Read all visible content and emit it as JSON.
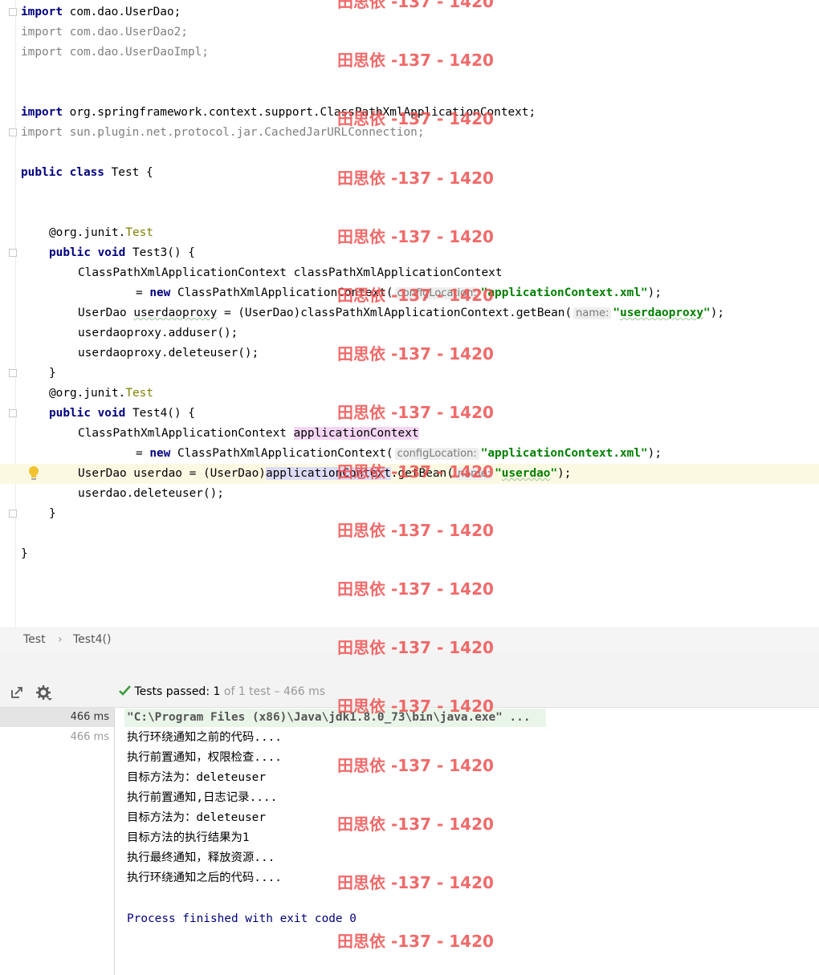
{
  "editor": {
    "imports": [
      {
        "kw": "import",
        "path": "com.dao.UserDao;",
        "unused": false
      },
      {
        "kw": "import",
        "path": "com.dao.UserDao2;",
        "unused": true
      },
      {
        "kw": "import",
        "path": "com.dao.UserDaoImpl;",
        "unused": true
      },
      {
        "kw": "import",
        "path": "org.springframework.context.support.ClassPathXmlApplicationContext;",
        "unused": false
      },
      {
        "kw": "import",
        "path": "sun.plugin.net.protocol.jar.CachedJarURLConnection;",
        "unused": true
      }
    ],
    "class_decl": {
      "kw": "public class",
      "rest": " Test {"
    },
    "test3": {
      "annotation_prefix": "@org.junit.",
      "annotation_name": "Test",
      "sig_kw": "public void",
      "sig_rest": " Test3() {",
      "l1": "ClassPathXmlApplicationContext classPathXmlApplicationContext",
      "l2_eq": "= ",
      "l2_kw": "new",
      "l2_rest": " ClassPathXmlApplicationContext(",
      "l2_hint": "configLocation:",
      "l2_str": "\"applicationContext.xml\"",
      "l2_end": ");",
      "l3_pre": "UserDao ",
      "l3_var": "userdaoproxy",
      "l3_mid": " = (UserDao)classPathXmlApplicationContext.getBean(",
      "l3_hint": "name:",
      "l3_str_q1": "\"",
      "l3_str": "userdaoproxy",
      "l3_str_q2": "\"",
      "l3_end": ");",
      "l4": "userdaoproxy.adduser();",
      "l5": "userdaoproxy.deleteuser();",
      "close": "}"
    },
    "test4": {
      "annotation_prefix": "@org.junit.",
      "annotation_name": "Test",
      "sig_kw": "public void",
      "sig_rest": " Test4() {",
      "l1_pre": "ClassPathXmlApplicationContext ",
      "l1_var": "applicationContext",
      "l2_eq": "= ",
      "l2_kw": "new",
      "l2_rest": " ClassPathXmlApplicationContext(",
      "l2_hint": "configLocation:",
      "l2_str": "\"applicationContext.xml\"",
      "l2_end": ");",
      "l3_pre": "UserDao userdao = (UserDao)",
      "l3_var": "applicationContext",
      "l3_mid": ".getBean(",
      "l3_hint": "name:",
      "l3_str_q1": "\"",
      "l3_str": "userdao",
      "l3_str_q2": "\"",
      "l3_end": ");",
      "l4": "userdao.deleteuser();",
      "close": "}"
    },
    "class_close": "}"
  },
  "breadcrumb": {
    "items": [
      "Test",
      "Test4()"
    ],
    "separator": "›"
  },
  "run": {
    "status_label": "Tests passed:",
    "status_count": "1",
    "status_rest": "of 1 test – 466 ms",
    "tree": [
      {
        "time": "466 ms"
      },
      {
        "time": "466 ms"
      }
    ],
    "command": "\"C:\\Program Files (x86)\\Java\\jdk1.8.0_73\\bin\\java.exe\" ...",
    "output": [
      "执行环绕通知之前的代码....",
      "执行前置通知，权限检查....",
      "目标方法为：deleteuser",
      "执行前置通知,日志记录....",
      "目标方法为：deleteuser",
      "目标方法的执行结果为1",
      "执行最终通知，释放资源...",
      "执行环绕通知之后的代码...."
    ],
    "exit_message": "Process finished with exit code 0"
  },
  "watermark": {
    "text": "田思依 -137 - 1420",
    "count": 17
  },
  "colors": {
    "keyword": "#000080",
    "string": "#008000",
    "annotation": "#808000",
    "unused_import": "#808080",
    "watermark": "#ee5050",
    "pass_check": "#3d9b3d"
  }
}
